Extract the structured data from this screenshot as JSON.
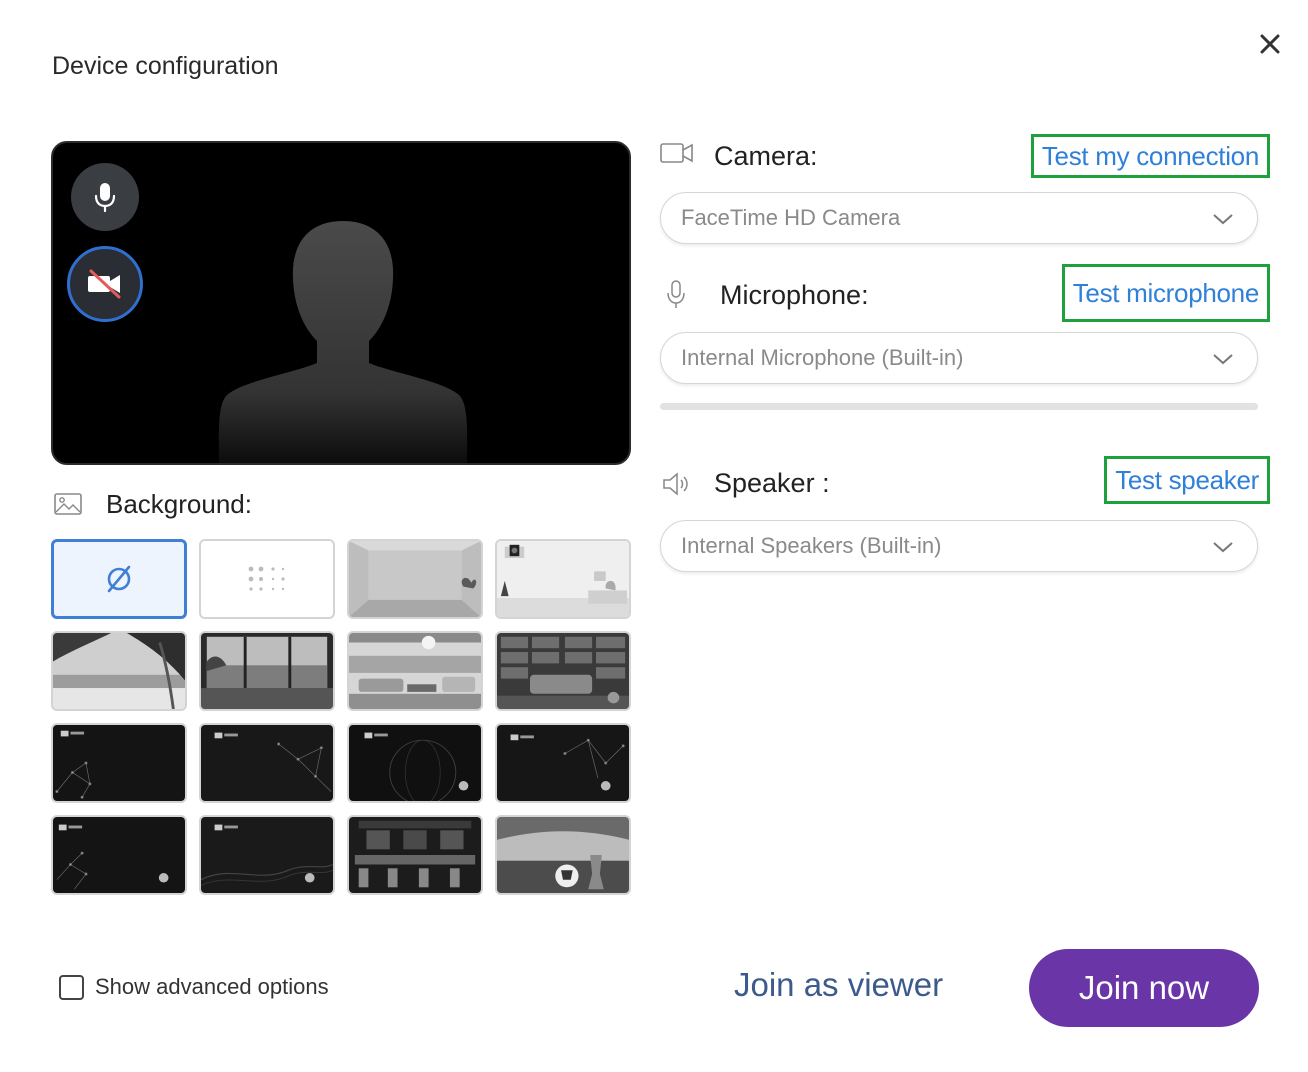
{
  "dialog": {
    "title": "Device configuration",
    "close_icon": "close-icon"
  },
  "preview": {
    "mic_icon": "microphone-icon",
    "camera_icon": "camera-off-icon"
  },
  "background": {
    "label": "Background:",
    "icon": "image-icon",
    "tiles": [
      {
        "name": "none",
        "icon": "no-background-icon",
        "selected": true
      },
      {
        "name": "blur",
        "icon": "blur-icon"
      },
      {
        "name": "empty-room"
      },
      {
        "name": "white-room-camera"
      },
      {
        "name": "beach-palms"
      },
      {
        "name": "ocean-window"
      },
      {
        "name": "modern-living-room"
      },
      {
        "name": "bookshelf-library"
      },
      {
        "name": "dark-network-1"
      },
      {
        "name": "dark-network-2"
      },
      {
        "name": "dark-globe"
      },
      {
        "name": "dark-network-3"
      },
      {
        "name": "dark-network-4"
      },
      {
        "name": "dark-waves"
      },
      {
        "name": "bar-interior"
      },
      {
        "name": "stadium-trophy"
      }
    ]
  },
  "camera": {
    "label": "Camera:",
    "icon": "video-camera-icon",
    "test_label": "Test my connection",
    "selected": "FaceTime HD Camera"
  },
  "microphone": {
    "label": "Microphone:",
    "icon": "microphone-outline-icon",
    "test_label": "Test microphone",
    "selected": "Internal Microphone (Built-in)",
    "level": 0
  },
  "speaker": {
    "label": "Speaker :",
    "icon": "speaker-icon",
    "test_label": "Test speaker",
    "selected": "Internal Speakers (Built-in)"
  },
  "footer": {
    "advanced_label": "Show advanced options",
    "advanced_checked": false,
    "viewer_label": "Join as viewer",
    "join_label": "Join now"
  },
  "colors": {
    "accent_blue": "#3f7fd6",
    "link_blue": "#2f80d8",
    "highlight_green": "#1ea13d",
    "join_purple": "#6a35a7",
    "viewer_blue": "#3d5a8c"
  }
}
